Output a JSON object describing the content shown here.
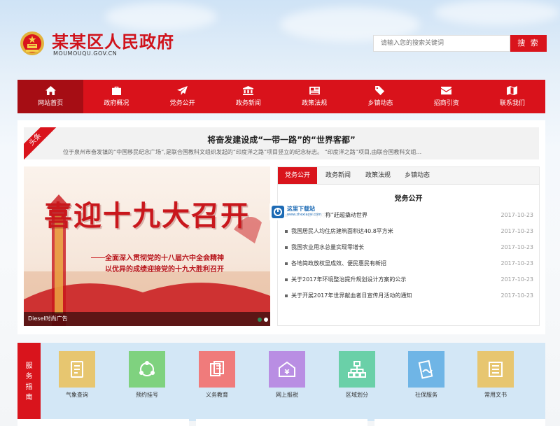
{
  "header": {
    "site_title": "某某区人民政府",
    "site_domain": "MOUMOUQU.GOV.CN",
    "search_placeholder": "请输入您的搜索关键词",
    "search_button": "搜 索",
    "emblem_icon": "national-emblem-icon"
  },
  "nav": {
    "items": [
      {
        "label": "网站首页",
        "icon": "home-icon",
        "active": true
      },
      {
        "label": "政府概况",
        "icon": "briefcase-icon"
      },
      {
        "label": "党务公开",
        "icon": "paper-plane-icon"
      },
      {
        "label": "政务新闻",
        "icon": "institution-icon"
      },
      {
        "label": "政策法规",
        "icon": "newspaper-icon"
      },
      {
        "label": "乡镇动态",
        "icon": "tags-icon"
      },
      {
        "label": "招商引资",
        "icon": "envelope-icon"
      },
      {
        "label": "联系我们",
        "icon": "map-icon"
      }
    ]
  },
  "headline": {
    "ribbon": "头条",
    "title": "将奋发建设成“一带一路”的“世界客都”",
    "summary": "位于泉州市奋发镇的“中国移民纪念广场”,是联合国教科文组织发起的“印度洋之路”项目竖立的纪念标志。       “印度洋之路”项目,由联合国教科文组..."
  },
  "slider": {
    "title": "喜迎十九大召开",
    "line1": "全面深入贯彻党的十八届六中全会精神",
    "line2": "以优异的成绩迎接党的十九大胜利召开",
    "caption": "Diesel时尚广告",
    "active_dot": 2,
    "dot_count": 2
  },
  "news": {
    "tabs": [
      "党务公开",
      "政务新闻",
      "政策法规",
      "乡镇动态"
    ],
    "active_tab": 0,
    "panel_heading": "党务公开",
    "items": [
      {
        "title": "C“非对称”赶超撬动世界",
        "date": "2017-10-23"
      },
      {
        "title": "我国居民人均住房建筑面积达40.8平方米",
        "date": "2017-10-23"
      },
      {
        "title": "我国农业用水总量实现零增长",
        "date": "2017-10-23"
      },
      {
        "title": "各地简政放权显成效、便民惠民有新招",
        "date": "2017-10-23"
      },
      {
        "title": "关于2017年环境整治提升规划设计方案的公示",
        "date": "2017-10-23"
      },
      {
        "title": "关于开展2017年世界献血者日宣传月活动的通知",
        "date": "2017-10-23"
      }
    ],
    "watermark": {
      "line1": "这里下载站",
      "line2": "www.zhexiazai.com"
    }
  },
  "service": {
    "label_chars": [
      "服",
      "务",
      "指",
      "南"
    ],
    "items": [
      {
        "label": "气象查询",
        "icon": "weather-doc-icon",
        "color": "#e7c670"
      },
      {
        "label": "预约挂号",
        "icon": "share-circle-icon",
        "color": "#7fd27f"
      },
      {
        "label": "义务教育",
        "icon": "copy-doc-icon",
        "color": "#f07b7b"
      },
      {
        "label": "网上报税",
        "icon": "yen-tax-icon",
        "color": "#b98ee3"
      },
      {
        "label": "区域划分",
        "icon": "sitemap-icon",
        "color": "#6ad0a8"
      },
      {
        "label": "社保服务",
        "icon": "contract-icon",
        "color": "#6fb5e6"
      },
      {
        "label": "常用文书",
        "icon": "list-doc-icon",
        "color": "#e7c670"
      }
    ]
  },
  "colors": {
    "brand_red": "#d9141c",
    "nav_active": "#a60d14",
    "service_bg": "#d3e7f6"
  }
}
